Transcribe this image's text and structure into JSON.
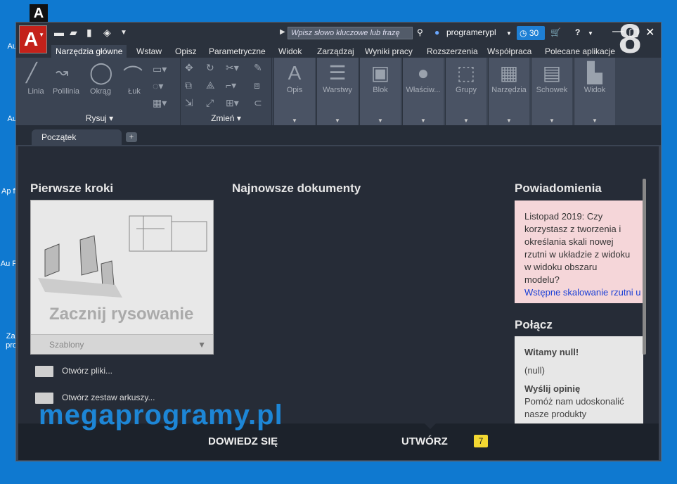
{
  "desktop": {
    "icons": [
      "Au",
      "Au",
      "Ap fi",
      "Au F",
      "Zai pro"
    ]
  },
  "top_mark": "A",
  "title_bar": {
    "logo": "A",
    "search_placeholder": "Wpisz słowo kluczowe lub frazę",
    "user": "programerypl",
    "timer": "30",
    "help": "?"
  },
  "tabs": [
    "Narzędzia główne",
    "Wstaw",
    "Opisz",
    "Parametryczne",
    "Widok",
    "Zarządzaj",
    "Wyniki pracy",
    "Rozszerzenia",
    "Współpraca",
    "Polecane aplikacje"
  ],
  "ribbon": {
    "draw_tools": [
      "Linia",
      "Polilinia",
      "Okrąg",
      "Łuk"
    ],
    "draw_panel": "Rysuj",
    "modify_panel": "Zmień",
    "big_buttons": [
      "Opis",
      "Warstwy",
      "Blok",
      "Właściw...",
      "Grupy",
      "Narzędzia",
      "Schowek",
      "Widok"
    ]
  },
  "doc_tab": "Początek",
  "start": {
    "first_steps": "Pierwsze kroki",
    "start_drawing": "Zacznij rysowanie",
    "templates": "Szablony",
    "open_files": "Otwórz pliki...",
    "open_sheet_set": "Otwórz zestaw arkuszy...",
    "recent_docs": "Najnowsze dokumenty",
    "notifications": "Powiadomienia",
    "notif_text": "Listopad 2019: Czy korzystasz z tworzenia i określania skali nowej rzutni w układzie z widoku w widoku obszaru modelu?",
    "notif_link": "Wstępne skalowanie rzutni u",
    "connect": "Połącz",
    "welcome": "Witamy null!",
    "null_text": "(null)",
    "send_feedback": "Wyślij opinię",
    "feedback_text": "Pomóż nam udoskonalić nasze produkty"
  },
  "bottom": {
    "learn": "DOWIEDZ SIĘ",
    "create": "UTWÓRZ",
    "badge": "7"
  },
  "watermark": "megaprogramy.pl",
  "version_mark": "8"
}
